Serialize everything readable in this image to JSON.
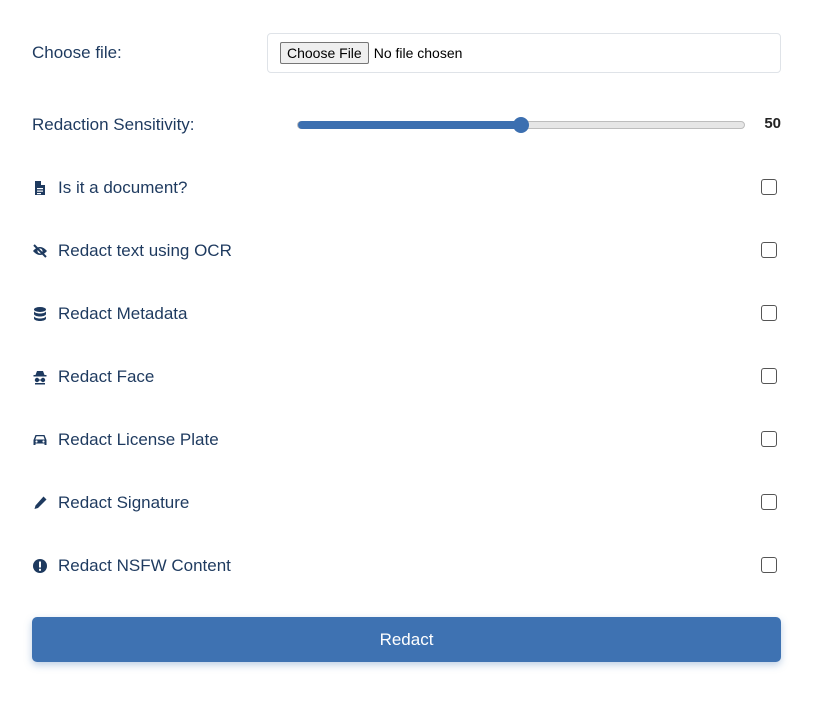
{
  "file": {
    "label": "Choose file:",
    "button_label": "Choose File",
    "status": "No file chosen"
  },
  "slider": {
    "label": "Redaction Sensitivity:",
    "value": "50",
    "fraction": 0.5
  },
  "options": [
    {
      "label": "Is it a document?",
      "icon": "document-icon"
    },
    {
      "label": "Redact text using OCR",
      "icon": "eye-slash-icon"
    },
    {
      "label": "Redact Metadata",
      "icon": "database-icon"
    },
    {
      "label": "Redact Face",
      "icon": "incognito-icon"
    },
    {
      "label": "Redact License Plate",
      "icon": "car-icon"
    },
    {
      "label": "Redact Signature",
      "icon": "pen-icon"
    },
    {
      "label": "Redact NSFW Content",
      "icon": "exclamation-circle-icon"
    }
  ],
  "submit": {
    "label": "Redact"
  },
  "colors": {
    "accent": "#3e72b2",
    "text": "#1e3a5f"
  }
}
